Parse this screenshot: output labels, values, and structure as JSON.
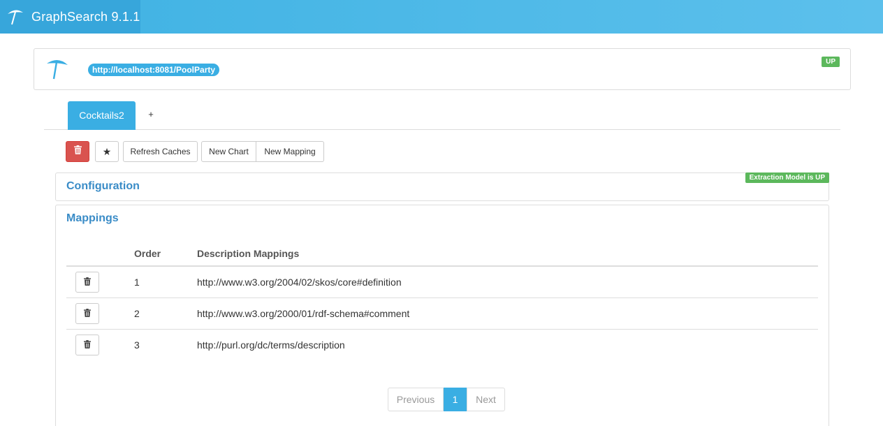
{
  "app": {
    "title": "GraphSearch 9.1.1"
  },
  "server": {
    "url": "http://localhost:8081/PoolParty",
    "status": "UP"
  },
  "tabs": {
    "active_label": "Cocktails2",
    "add_label": "+"
  },
  "toolbar": {
    "delete_icon": "trash-icon",
    "star_label": "★",
    "refresh_label": "Refresh Caches",
    "new_chart_label": "New Chart",
    "new_mapping_label": "New Mapping"
  },
  "configuration": {
    "title": "Configuration",
    "status": "Extraction Model is UP"
  },
  "mappings": {
    "title": "Mappings",
    "columns": [
      "",
      "Order",
      "Description Mappings"
    ],
    "rows": [
      {
        "order": "1",
        "description": "http://www.w3.org/2004/02/skos/core#definition"
      },
      {
        "order": "2",
        "description": "http://www.w3.org/2000/01/rdf-schema#comment"
      },
      {
        "order": "3",
        "description": "http://purl.org/dc/terms/description"
      }
    ]
  },
  "pagination": {
    "previous": "Previous",
    "current": "1",
    "next": "Next"
  },
  "colors": {
    "accent": "#3aaee3",
    "danger": "#d9534f",
    "success": "#5cb85c",
    "title": "#3a8cc7"
  }
}
